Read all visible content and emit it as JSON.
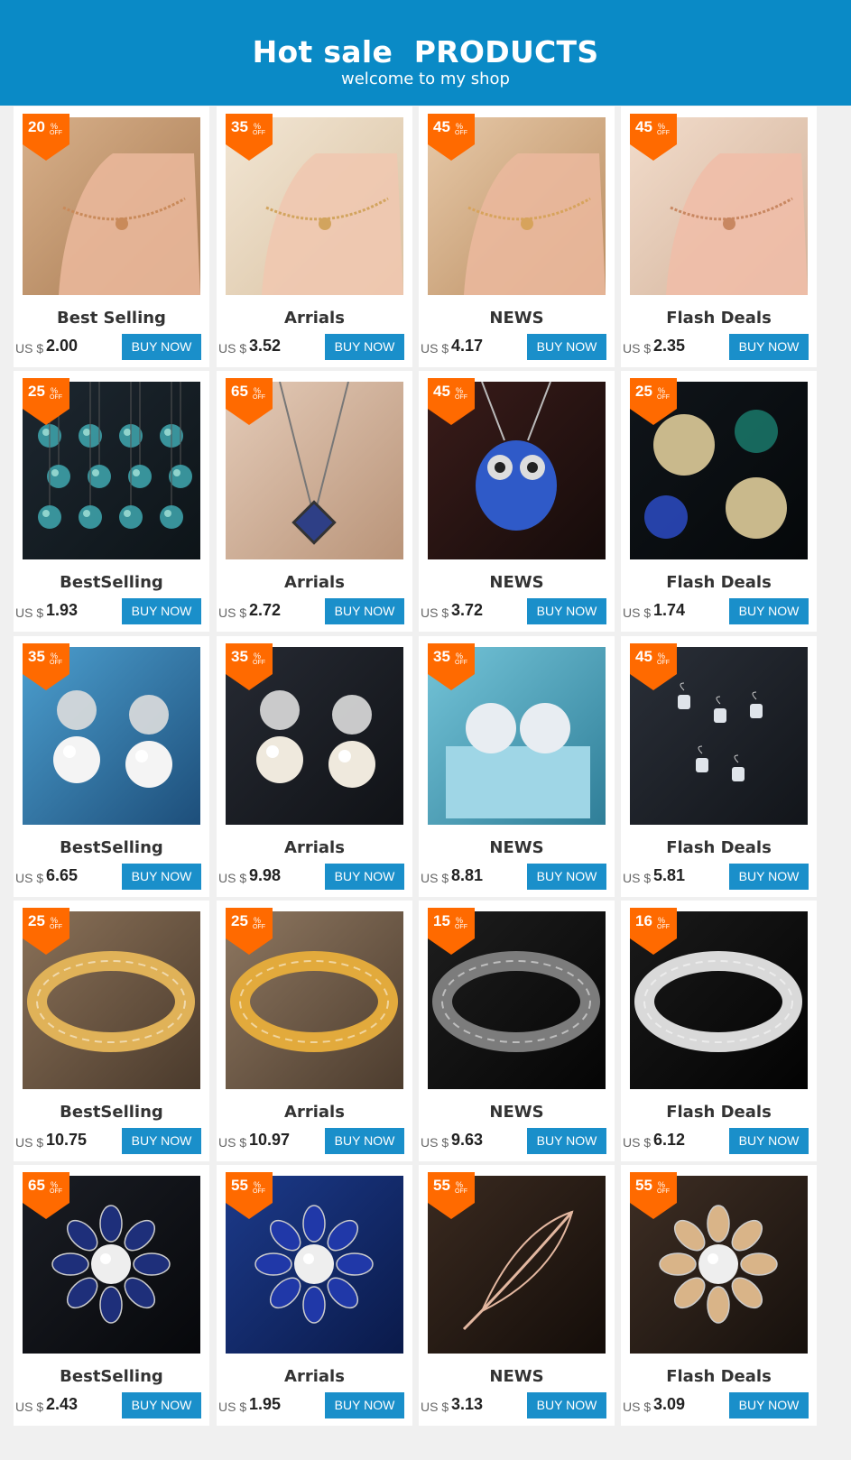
{
  "header": {
    "title": "Hot sale  PRODUCTS",
    "subtitle": "welcome to my shop"
  },
  "colors": {
    "header_bg": "#0a8ac6",
    "badge": "#ff6a00",
    "button": "#1a8fca"
  },
  "currency": "US $",
  "buy_label": "BUY NOW",
  "badge_suffix": "%",
  "badge_off": "OFF",
  "products": [
    {
      "label": "Best Selling",
      "price": "2.00",
      "discount": "20",
      "image": "anklet-heart-icon"
    },
    {
      "label": "Arrials",
      "price": "3.52",
      "discount": "35",
      "image": "anklet-zodiac-icon"
    },
    {
      "label": "NEWS",
      "price": "4.17",
      "discount": "45",
      "image": "anklet-butterfly-icon"
    },
    {
      "label": "Flash Deals",
      "price": "2.35",
      "discount": "45",
      "image": "anklet-letter-icon"
    },
    {
      "label": "BestSelling",
      "price": "1.93",
      "discount": "25",
      "image": "zodiac-necklaces-icon"
    },
    {
      "label": "Arrials",
      "price": "2.72",
      "discount": "65",
      "image": "long-pendant-necklace-icon"
    },
    {
      "label": "NEWS",
      "price": "3.72",
      "discount": "45",
      "image": "owl-pendant-icon"
    },
    {
      "label": "Flash Deals",
      "price": "1.74",
      "discount": "25",
      "image": "glow-locket-icon"
    },
    {
      "label": "BestSelling",
      "price": "6.65",
      "discount": "35",
      "image": "pearl-flower-earrings-icon"
    },
    {
      "label": "Arrials",
      "price": "9.98",
      "discount": "35",
      "image": "pearl-leaf-earrings-icon"
    },
    {
      "label": "NEWS",
      "price": "8.81",
      "discount": "35",
      "image": "crystal-stud-earrings-icon"
    },
    {
      "label": "Flash Deals",
      "price": "5.81",
      "discount": "45",
      "image": "drop-earrings-icon"
    },
    {
      "label": "BestSelling",
      "price": "10.75",
      "discount": "25",
      "image": "two-tone-bracelet-icon"
    },
    {
      "label": "Arrials",
      "price": "10.97",
      "discount": "25",
      "image": "gold-bracelet-icon"
    },
    {
      "label": "NEWS",
      "price": "9.63",
      "discount": "15",
      "image": "black-bracelet-icon"
    },
    {
      "label": "Flash Deals",
      "price": "6.12",
      "discount": "16",
      "image": "steel-watch-bracelet-icon"
    },
    {
      "label": "BestSelling",
      "price": "2.43",
      "discount": "65",
      "image": "blue-snowflake-brooch-icon"
    },
    {
      "label": "Arrials",
      "price": "1.95",
      "discount": "55",
      "image": "blue-flower-brooch-icon"
    },
    {
      "label": "NEWS",
      "price": "3.13",
      "discount": "55",
      "image": "feather-brooch-icon"
    },
    {
      "label": "Flash Deals",
      "price": "3.09",
      "discount": "55",
      "image": "gold-flower-brooch-icon"
    }
  ]
}
